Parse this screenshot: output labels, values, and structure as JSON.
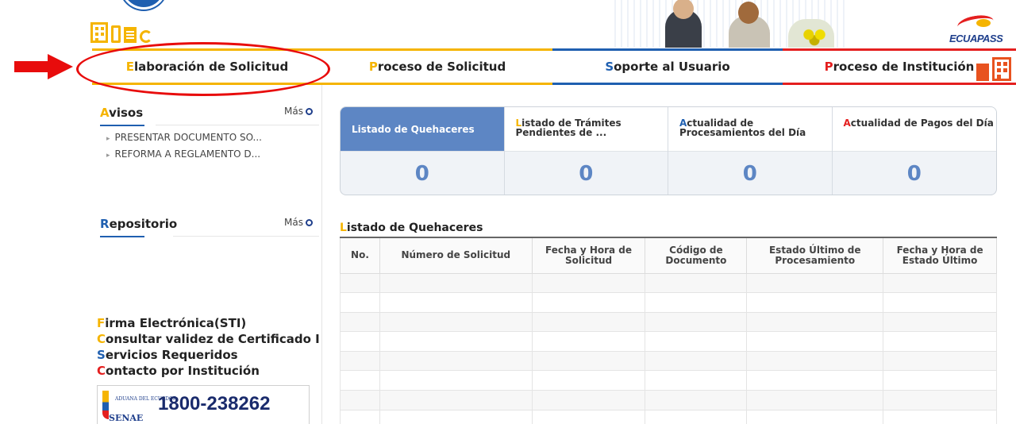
{
  "header": {
    "brand_logo": "ECUAPASS"
  },
  "nav": {
    "items": [
      {
        "lead": "E",
        "rest": "laboración de Solicitud"
      },
      {
        "lead": "P",
        "rest": "roceso de Solicitud"
      },
      {
        "lead": "S",
        "rest": "oporte al Usuario"
      },
      {
        "lead": "P",
        "rest": "roceso de Institución"
      }
    ]
  },
  "sidebar": {
    "avisos": {
      "lead": "A",
      "rest": "visos",
      "more": "Más",
      "items": [
        "PRESENTAR DOCUMENTO SO...",
        "REFORMA A REGLAMENTO D..."
      ]
    },
    "repositorio": {
      "lead": "R",
      "rest": "epositorio",
      "more": "Más"
    },
    "links": [
      {
        "lead": "F",
        "rest": "irma Electrónica(STI)"
      },
      {
        "lead": "C",
        "rest": "onsultar validez de Certificado I"
      },
      {
        "lead": "S",
        "rest": "ervicios Requeridos"
      },
      {
        "lead": "C",
        "rest": "ontacto por Institución"
      }
    ],
    "banner": {
      "small_text": "ADUANA DEL ECUADOR",
      "name": "SENAE",
      "phone": "1800-238262"
    }
  },
  "main": {
    "cards": [
      {
        "lead": "",
        "rest": "Listado de Quehaceres",
        "count": "0",
        "active": true
      },
      {
        "lead": "L",
        "rest": "istado de Trámites Pendientes de ...",
        "count": "0"
      },
      {
        "lead": "A",
        "rest": "ctualidad de Procesamientos del Día",
        "count": "0"
      },
      {
        "lead": "A",
        "rest": "ctualidad de Pagos del Día",
        "count": "0"
      }
    ],
    "table": {
      "title_lead": "L",
      "title_rest": "istado de Quehaceres",
      "columns": [
        "No.",
        "Número de Solicitud",
        "Fecha y Hora de Solicitud",
        "Código de Documento",
        "Estado Último de Procesamiento",
        "Fecha y Hora de Estado Último"
      ],
      "rows": 8
    }
  },
  "colors": {
    "yellow": "#f5b400",
    "blue": "#1f5fb0",
    "red": "#e41f1f",
    "card_active": "#5d86c4"
  }
}
